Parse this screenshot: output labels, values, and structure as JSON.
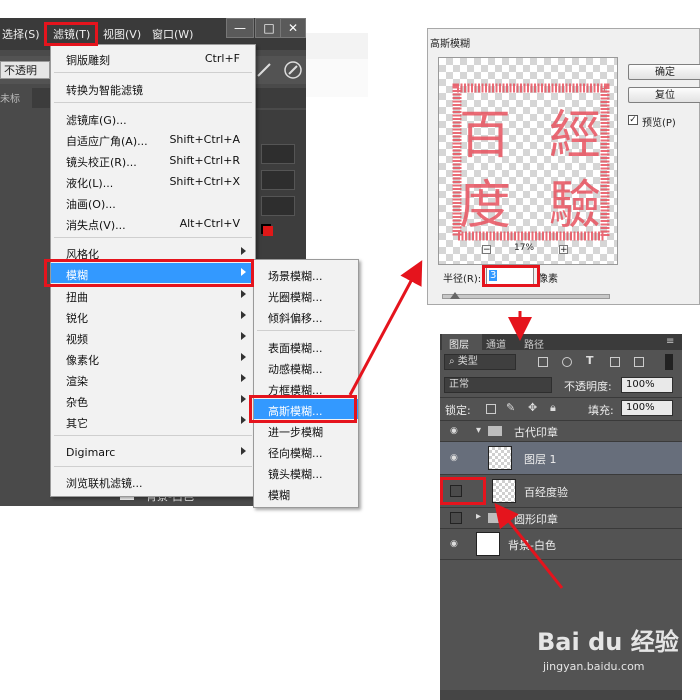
{
  "photoshop": {
    "menubar": [
      {
        "label": "选择(S)"
      },
      {
        "label": "滤镜(T)"
      },
      {
        "label": "视图(V)"
      },
      {
        "label": "窗口(W)"
      }
    ],
    "window_controls": {
      "minimize": "—",
      "restore": "□",
      "close": "✕"
    },
    "options_bar": {
      "opacity_label": "不透明"
    },
    "tab_label": "未标",
    "bottom_layer_label": "背景-白色"
  },
  "filter_menu": {
    "items": [
      {
        "label": "铜版雕刻",
        "shortcut": "Ctrl+F"
      },
      {
        "label": "转换为智能滤镜",
        "shortcut": ""
      },
      {
        "label": "滤镜库(G)...",
        "shortcut": ""
      },
      {
        "label": "自适应广角(A)...",
        "shortcut": "Shift+Ctrl+A"
      },
      {
        "label": "镜头校正(R)...",
        "shortcut": "Shift+Ctrl+R"
      },
      {
        "label": "液化(L)...",
        "shortcut": "Shift+Ctrl+X"
      },
      {
        "label": "油画(O)...",
        "shortcut": ""
      },
      {
        "label": "消失点(V)...",
        "shortcut": "Alt+Ctrl+V"
      },
      {
        "label": "风格化",
        "shortcut": ""
      },
      {
        "label": "模糊",
        "shortcut": ""
      },
      {
        "label": "扭曲",
        "shortcut": ""
      },
      {
        "label": "锐化",
        "shortcut": ""
      },
      {
        "label": "视频",
        "shortcut": ""
      },
      {
        "label": "像素化",
        "shortcut": ""
      },
      {
        "label": "渲染",
        "shortcut": ""
      },
      {
        "label": "杂色",
        "shortcut": ""
      },
      {
        "label": "其它",
        "shortcut": ""
      },
      {
        "label": "Digimarc",
        "shortcut": ""
      },
      {
        "label": "浏览联机滤镜...",
        "shortcut": ""
      }
    ]
  },
  "blur_menu": {
    "items": [
      {
        "label": "场景模糊..."
      },
      {
        "label": "光圈模糊..."
      },
      {
        "label": "倾斜偏移..."
      },
      {
        "label": "表面模糊..."
      },
      {
        "label": "动感模糊..."
      },
      {
        "label": "方框模糊..."
      },
      {
        "label": "高斯模糊..."
      },
      {
        "label": "进一步模糊"
      },
      {
        "label": "径向模糊..."
      },
      {
        "label": "镜头模糊..."
      },
      {
        "label": "模糊"
      }
    ]
  },
  "gaussian_dialog": {
    "title": "高斯模糊",
    "ok_label": "确定",
    "reset_label": "复位",
    "preview_label": "预览(P)",
    "preview_checked": "✓",
    "zoom_out": "−",
    "zoom_in": "+",
    "zoom": "17%",
    "radius_label": "半径(R):",
    "radius_value": "3",
    "unit": "像素",
    "seal_chars": [
      "百",
      "經",
      "度",
      "驗"
    ],
    "seal_color": "#e8525f"
  },
  "layers_panel": {
    "tabs": [
      "图层",
      "通道",
      "路径"
    ],
    "filter_type": "类型",
    "blend_mode": "正常",
    "opacity_label": "不透明度:",
    "opacity_value": "100%",
    "lock_label": "锁定:",
    "fill_label": "填充:",
    "fill_value": "100%",
    "layers": [
      {
        "name": "古代印章"
      },
      {
        "name": "图层 1"
      },
      {
        "name": "百经度验"
      },
      {
        "name": "圆形印章"
      },
      {
        "name": "背景-白色"
      }
    ]
  },
  "watermark": {
    "logo": "Bai du 经验",
    "url": "jingyan.baidu.com"
  },
  "colors": {
    "highlight_red": "#e5141d",
    "menu_selection": "#3399ff"
  }
}
